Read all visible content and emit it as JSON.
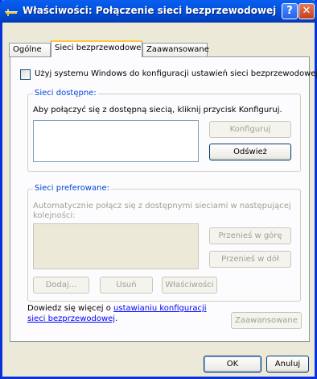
{
  "window": {
    "title": "Właściwości: Połączenie sieci bezprzewodowej",
    "help_label": "?",
    "close_label": "✕"
  },
  "tabs": [
    {
      "label": "Ogólne"
    },
    {
      "label": "Sieci bezprzewodowe"
    },
    {
      "label": "Zaawansowane"
    }
  ],
  "use_windows": {
    "label": "Użyj systemu Windows do konfiguracji ustawień sieci bezprzewodowej",
    "checked": false
  },
  "available": {
    "legend": "Sieci dostępne:",
    "description": "Aby połączyć się z dostępną siecią, kliknij przycisk Konfiguruj.",
    "configure_label": "Konfiguruj",
    "refresh_label": "Odśwież"
  },
  "preferred": {
    "legend": "Sieci preferowane:",
    "description_line1": "Automatycznie połącz się z dostępnymi sieciami w następującej",
    "description_line2": "kolejności:",
    "move_up_label": "Przenieś w górę",
    "move_down_label": "Przenieś w dół",
    "add_label": "Dodaj...",
    "remove_label": "Usuń",
    "properties_label": "Właściwości"
  },
  "learn_more": {
    "prefix": "Dowiedz się więcej o",
    "link_line1": "ustawianiu konfiguracji",
    "link_line2": "sieci bezprzewodowej",
    "suffix": "."
  },
  "advanced_label": "Zaawansowane",
  "footer": {
    "ok_label": "OK",
    "cancel_label": "Anuluj"
  }
}
